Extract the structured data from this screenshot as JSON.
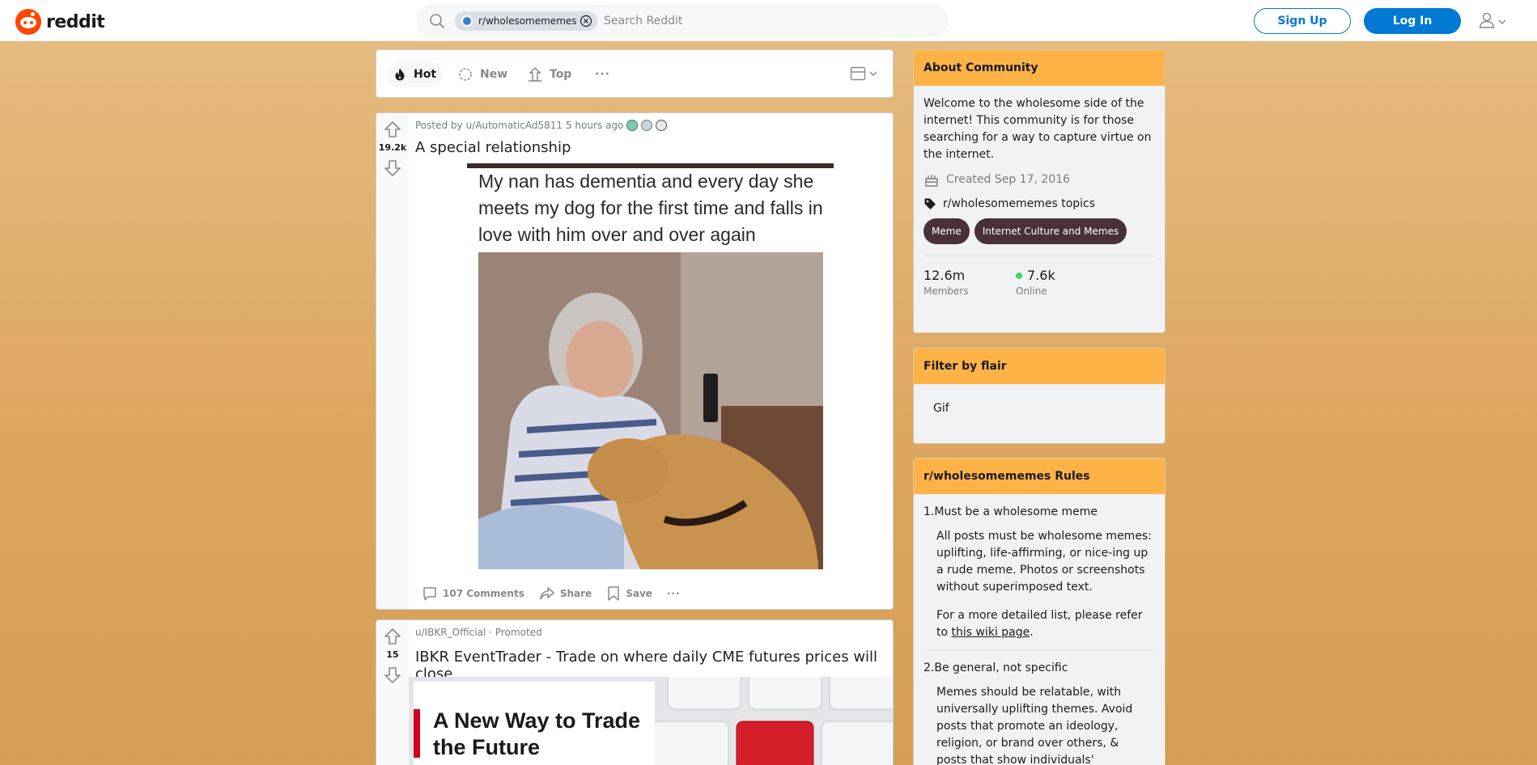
{
  "header": {
    "logo_text": "reddit",
    "search_chip": "r/wholesomememes",
    "search_placeholder": "Search Reddit",
    "signup_label": "Sign Up",
    "login_label": "Log In",
    "accent_color": "#0079d3",
    "brand_color": "#ff4500"
  },
  "sort": {
    "hot": "Hot",
    "new": "New",
    "top": "Top",
    "more": "···"
  },
  "posts": [
    {
      "votes": "19.2k",
      "posted_by_prefix": "Posted by",
      "author": "u/AutomaticAd5811",
      "time": "5 hours ago",
      "title": "A special relationship",
      "image_text": "My nan has dementia and every day she meets my dog for the first time and falls in love with him over and over again",
      "comments": "107 Comments",
      "share": "Share",
      "save": "Save",
      "more": "···"
    },
    {
      "votes": "15",
      "author": "u/IBKR_Official",
      "promoted": "· Promoted",
      "title": "IBKR EventTrader - Trade on where daily CME futures prices will close",
      "ad_headline": "A New Way to Trade the Future"
    }
  ],
  "about": {
    "header": "About Community",
    "description": "Welcome to the wholesome side of the internet! This community is for those searching for a way to capture virtue on the internet.",
    "created": "Created Sep 17, 2016",
    "topics_label": "r/wholesomememes topics",
    "topics": [
      "Meme",
      "Internet Culture and Memes"
    ],
    "members_count": "12.6m",
    "members_label": "Members",
    "online_count": "7.6k",
    "online_label": "Online"
  },
  "flair": {
    "header": "Filter by flair",
    "items": [
      "Gif"
    ]
  },
  "rules": {
    "header": "r/wholesomememes Rules",
    "items": [
      {
        "num": "1.",
        "title": "Must be a wholesome meme",
        "body1": "All posts must be wholesome memes: uplifting, life-affirming, or nice-ing up a rude meme. Photos or screenshots without superimposed text.",
        "body2_prefix": "For a more detailed list, please refer to ",
        "body2_link": "this wiki page",
        "body2_suffix": "."
      },
      {
        "num": "2.",
        "title": "Be general, not specific",
        "body1": "Memes should be relatable, with universally uplifting themes. Avoid posts that promote an ideology, religion, or brand over others, & posts that show individuals' politeness"
      }
    ]
  }
}
